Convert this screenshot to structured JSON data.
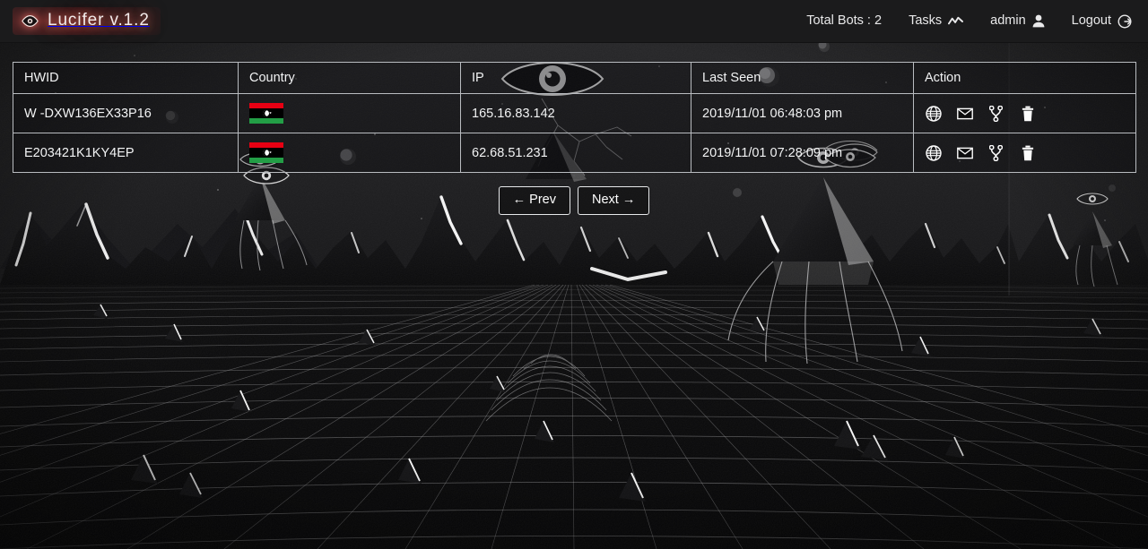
{
  "navbar": {
    "brand": {
      "label": "Lucifer v.1.2",
      "icon": "eye-icon",
      "glow_color": "#b03a33"
    },
    "total_bots": {
      "label": "Total Bots : 2",
      "count": 2
    },
    "tasks": {
      "label": "Tasks",
      "icon": "chart-line-icon"
    },
    "user": {
      "label": "admin",
      "icon": "user-icon"
    },
    "logout": {
      "label": "Logout",
      "icon": "sign-out-icon"
    }
  },
  "table": {
    "columns": [
      "HWID",
      "Country",
      "IP",
      "Last Seen",
      "Action"
    ],
    "rows": [
      {
        "hwid": "W -DXW136EX33P16",
        "country": "Libya",
        "country_code": "ly",
        "ip": "165.16.83.142",
        "last_seen": "2019/11/01 06:48:03 pm"
      },
      {
        "hwid": "E203421K1KY4EP",
        "country": "Libya",
        "country_code": "ly",
        "ip": "62.68.51.231",
        "last_seen": "2019/11/01 07:28:09 pm"
      }
    ],
    "action_icons": [
      "globe-icon",
      "envelope-icon",
      "code-fork-icon",
      "trash-icon"
    ]
  },
  "pagination": {
    "prev_label": "← Prev",
    "next_label": "Next →"
  }
}
